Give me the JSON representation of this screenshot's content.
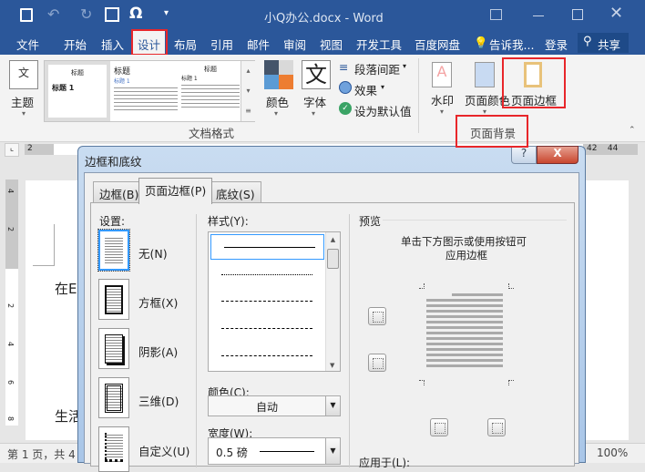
{
  "window": {
    "title": "小Q办公.docx - Word"
  },
  "quick_access": {
    "save": "save-icon",
    "undo": "undo-icon",
    "redo": "redo-icon",
    "symbol": "Ω"
  },
  "tabs": [
    "文件",
    "开始",
    "插入",
    "设计",
    "布局",
    "引用",
    "邮件",
    "审阅",
    "视图",
    "开发工具",
    "百度网盘"
  ],
  "tell_me": "告诉我...",
  "login": "登录",
  "share": "共享",
  "ribbon": {
    "theme": "主题",
    "gallery": {
      "title1": "标题",
      "heading1": "标题 1",
      "title2": "标题",
      "heading2": "标题 1",
      "title3": "标题",
      "heading3": "标题 1"
    },
    "colors": "颜色",
    "fonts": "字体",
    "fonts_glyph": "文",
    "paragraph_spacing": "段落间距",
    "effects": "效果",
    "set_default": "设为默认值",
    "group_doc_format": "文档格式",
    "watermark": "水印",
    "page_color": "页面颜色",
    "page_borders": "页面边框",
    "group_page_bg": "页面背景"
  },
  "ruler": {
    "left_num": "2",
    "right_nums": [
      "42",
      "44"
    ],
    "vertical": [
      "4",
      "2",
      "2",
      "4",
      "6",
      "8"
    ]
  },
  "document": {
    "line1": "在E",
    "line2": "生活"
  },
  "status": {
    "page": "第 1 页，共 4",
    "zoom": "100%"
  },
  "dialog": {
    "title": "边框和底纹",
    "help": "?",
    "close": "X",
    "tabs": [
      "边框(B)",
      "页面边框(P)",
      "底纹(S)"
    ],
    "settings_label": "设置:",
    "settings": [
      "无(N)",
      "方框(X)",
      "阴影(A)",
      "三维(D)",
      "自定义(U)"
    ],
    "style_label": "样式(Y):",
    "color_label": "颜色(C):",
    "color_value": "自动",
    "width_label": "宽度(W):",
    "width_value": "0.5 磅",
    "preview_label": "预览",
    "preview_hint1": "单击下方图示或使用按钮可",
    "preview_hint2": "应用边框",
    "apply_to_label": "应用于(L):"
  },
  "colors": {
    "title_bar": "#2b579a",
    "highlight": "#e8262a"
  }
}
